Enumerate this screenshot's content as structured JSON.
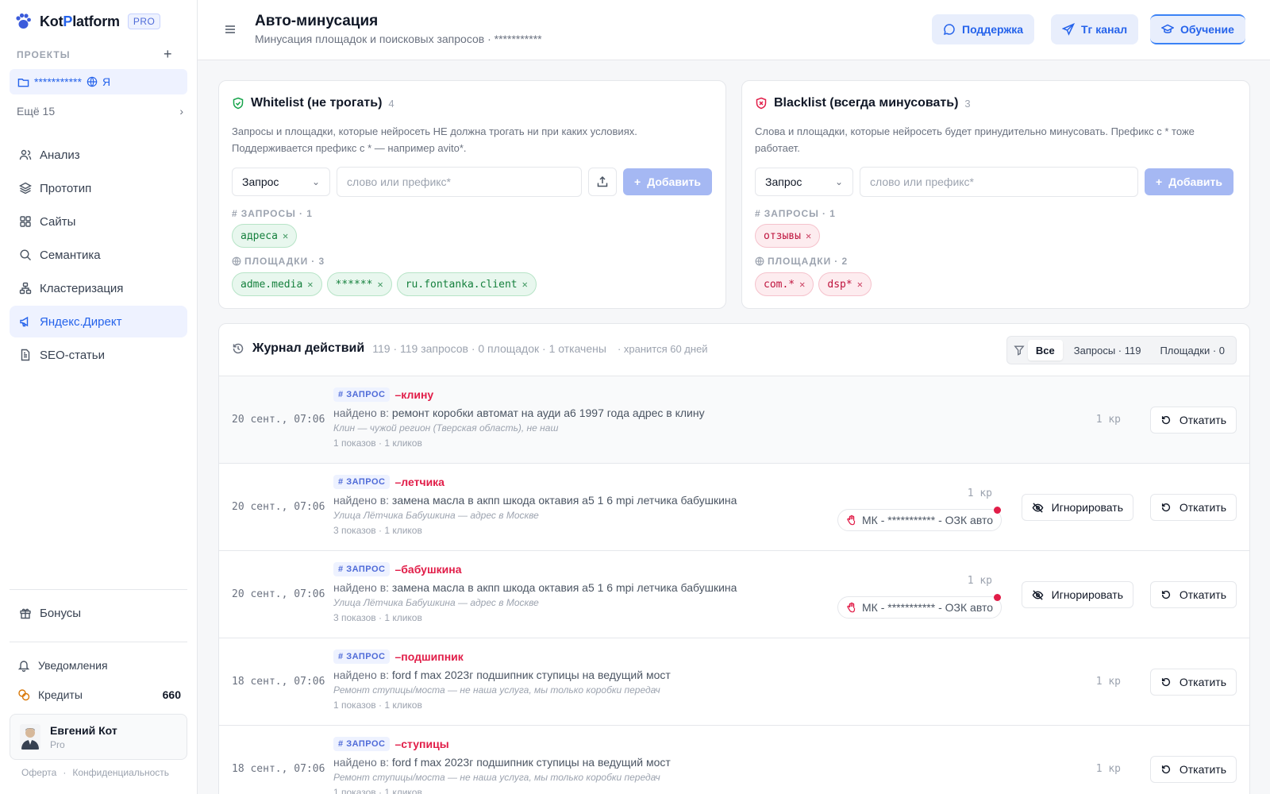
{
  "brand": {
    "name_a": "Kot",
    "name_b": "P",
    "name_c": "latform",
    "badge": "PRO"
  },
  "sidebar": {
    "projects_label": "ПРОЕКТЫ",
    "add_icon": "plus-icon",
    "project": {
      "name": "***********",
      "suffix": "Я"
    },
    "more": "Ещё 15",
    "nav": [
      {
        "label": "Анализ",
        "icon": "users-icon",
        "active": false
      },
      {
        "label": "Прототип",
        "icon": "layers-icon",
        "active": false
      },
      {
        "label": "Сайты",
        "icon": "grid-icon",
        "active": false
      },
      {
        "label": "Семантика",
        "icon": "search-icon",
        "active": false
      },
      {
        "label": "Кластеризация",
        "icon": "cluster-icon",
        "active": false
      },
      {
        "label": "Яндекс.Директ",
        "icon": "megaphone-icon",
        "active": true
      },
      {
        "label": "SEO-статьи",
        "icon": "document-icon",
        "active": false
      }
    ],
    "bonus": "Бонусы",
    "notifications": "Уведомления",
    "credits_label": "Кредиты",
    "credits_value": "660",
    "user": {
      "name": "Евгений Кот",
      "plan": "Pro"
    },
    "links": [
      "Оферта",
      "·",
      "Конфиденциальность"
    ]
  },
  "header": {
    "title": "Авто-минусация",
    "subtitle": "Минусация площадок и поисковых запросов · ***********",
    "buttons": {
      "support": "Поддержка",
      "tg": "Тг канал",
      "learn": "Обучение"
    }
  },
  "whitelist": {
    "title": "Whitelist (не трогать)",
    "count": "4",
    "desc1": "Запросы и площадки, которые нейросеть НЕ должна трогать ни при каких условиях.",
    "desc2": "Поддерживается префикс с * — например avito*.",
    "select": "Запрос",
    "placeholder": "слово или префикс*",
    "add": "Добавить",
    "queries_label": "ЗАПРОСЫ",
    "queries_count": "· 1",
    "queries": [
      "адреса"
    ],
    "sites_label": "ПЛОЩАДКИ",
    "sites_count": "· 3",
    "sites": [
      "adme.media",
      "******",
      "ru.fontanka.client"
    ]
  },
  "blacklist": {
    "title": "Blacklist (всегда минусовать)",
    "count": "3",
    "desc1": "Слова и площадки, которые нейросеть будет принудительно минусовать. Префикс с * тоже",
    "desc2": "работает.",
    "select": "Запрос",
    "placeholder": "слово или префикс*",
    "add": "Добавить",
    "queries_label": "ЗАПРОСЫ",
    "queries_count": "· 1",
    "queries": [
      "отзывы"
    ],
    "sites_label": "ПЛОЩАДКИ",
    "sites_count": "· 2",
    "sites": [
      "com.*",
      "dsp*"
    ]
  },
  "journal": {
    "title": "Журнал действий",
    "meta": "119 · 119 запросов · 0 площадок · 1 откачены",
    "keep": "· хранится 60 дней",
    "filters": [
      "Все",
      "Запросы · 119",
      "Площадки · 0"
    ],
    "tag": "ЗАПРОС",
    "found_label": "найдено в:",
    "rollback": "Откатить",
    "ignore": "Игнорировать",
    "rows": [
      {
        "date": "20 сент., 07:06",
        "word": "–клину",
        "found": "ремонт коробки автомат на ауди а6 1997 года адрес в клину",
        "reason": "Клин — чужой регион (Тверская область), не наш",
        "stats": "1 показов · 1 кликов",
        "cost": "1 кр",
        "campaign": ""
      },
      {
        "date": "20 сент., 07:06",
        "word": "–летчика",
        "found": "замена масла в акпп шкода октавия а5 1 6 mpi летчика бабушкина",
        "reason": "Улица Лётчика Бабушкина — адрес в Москве",
        "stats": "3 показов · 1 кликов",
        "cost": "1 кр",
        "campaign": "МК - *********** - ОЗК авто"
      },
      {
        "date": "20 сент., 07:06",
        "word": "–бабушкина",
        "found": "замена масла в акпп шкода октавия а5 1 6 mpi летчика бабушкина",
        "reason": "Улица Лётчика Бабушкина — адрес в Москве",
        "stats": "3 показов · 1 кликов",
        "cost": "1 кр",
        "campaign": "МК - *********** - ОЗК авто"
      },
      {
        "date": "18 сент., 07:06",
        "word": "–подшипник",
        "found": "ford f max 2023г подшипник ступицы на ведущий мост",
        "reason": "Ремонт ступицы/моста — не наша услуга, мы только коробки передач",
        "stats": "1 показов · 1 кликов",
        "cost": "1 кр",
        "campaign": ""
      },
      {
        "date": "18 сент., 07:06",
        "word": "–ступицы",
        "found": "ford f max 2023г подшипник ступицы на ведущий мост",
        "reason": "Ремонт ступицы/моста — не наша услуга, мы только коробки передач",
        "stats": "1 показов · 1 кликов",
        "cost": "1 кр",
        "campaign": ""
      }
    ]
  },
  "colors": {
    "accent": "#2563eb",
    "danger": "#e11d48",
    "success": "#15803d"
  }
}
